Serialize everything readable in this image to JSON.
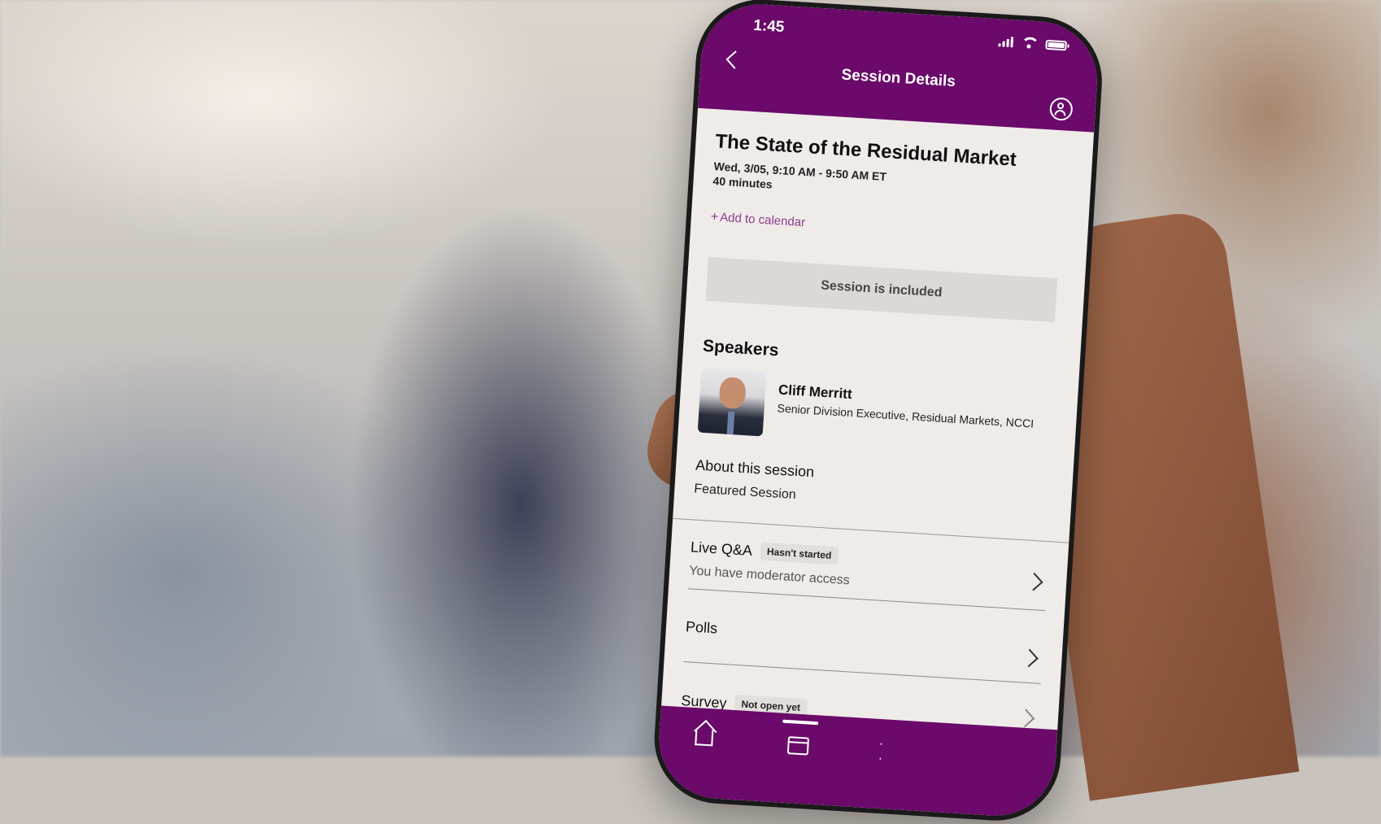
{
  "brand_color": "#6b0a6a",
  "status_bar": {
    "time": "1:45"
  },
  "nav": {
    "title": "Session Details",
    "back_icon": "chevron-left-icon",
    "profile_icon": "user-circle-icon"
  },
  "session": {
    "title": "The State of the Residual Market",
    "time": "Wed, 3/05, 9:10 AM - 9:50 AM ET",
    "duration": "40 minutes",
    "add_to_calendar": "Add to calendar",
    "add_to_calendar_prefix": "+",
    "included_label": "Session is included"
  },
  "speakers": {
    "heading": "Speakers",
    "items": [
      {
        "name": "Cliff Merritt",
        "role": "Senior Division Executive, Residual Markets, NCCI"
      }
    ]
  },
  "about": {
    "heading": "About this session",
    "text": "Featured Session"
  },
  "rows": {
    "live_qa": {
      "title": "Live Q&A",
      "badge": "Hasn't started",
      "subtitle": "You have moderator access"
    },
    "polls": {
      "title": "Polls"
    },
    "survey": {
      "title": "Survey",
      "badge": "Not open yet"
    }
  },
  "tabbar": {
    "items": [
      "home-icon",
      "calendar-icon",
      "network-icon"
    ],
    "active": "calendar-icon"
  }
}
